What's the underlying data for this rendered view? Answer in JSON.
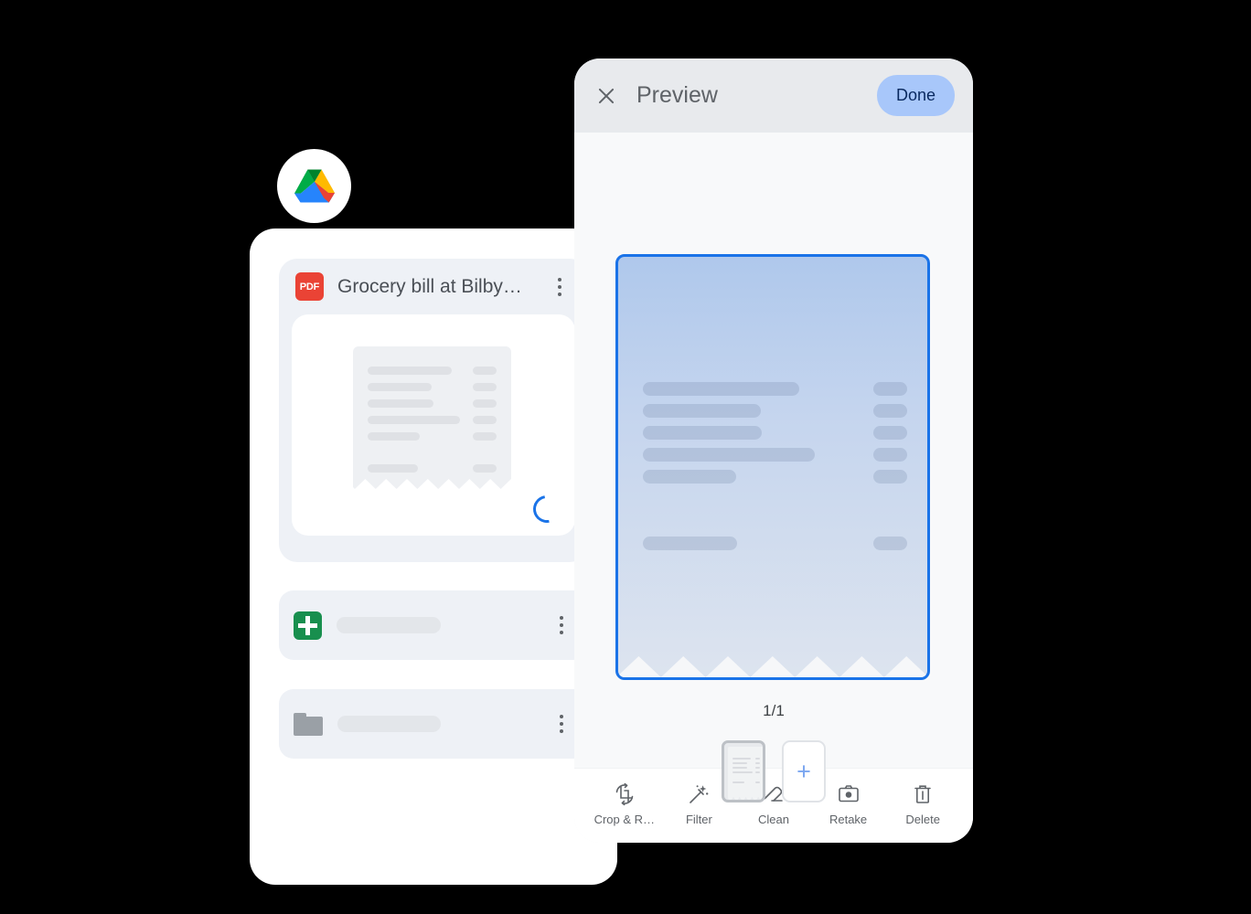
{
  "app": {
    "logo_icon": "google-drive-logo",
    "background_color": "#000000"
  },
  "files_card": {
    "featured_item": {
      "file_type_badge": "PDF",
      "badge_color": "#ea4335",
      "title": "Grocery bill at Bilby…",
      "overflow_icon": "kebab-menu-icon",
      "thumbnail_icon": "receipt-thumbnail",
      "status_icon": "loading-spinner",
      "spinner_color": "#1a73e8"
    },
    "rows": [
      {
        "icon": "google-sheets-icon",
        "icon_color": "#188f4e",
        "title": "",
        "overflow_icon": "kebab-menu-icon"
      },
      {
        "icon": "folder-icon",
        "icon_color": "#9aa0a6",
        "title": "",
        "overflow_icon": "kebab-menu-icon"
      }
    ]
  },
  "preview": {
    "header": {
      "close_icon": "close-icon",
      "title": "Preview",
      "done_label": "Done",
      "done_bg": "#a8c7fa",
      "done_text_color": "#09295f"
    },
    "document": {
      "selection_border_color": "#1a73e8",
      "content_icon": "receipt-document",
      "line_count": 6,
      "amount_count": 6
    },
    "page_counter": "1/1",
    "thumbnails": [
      {
        "name": "page-thumbnail-1",
        "selected": true,
        "label": ""
      }
    ],
    "add_page_label": "+",
    "toolbar": [
      {
        "icon": "crop-rotate-icon",
        "label": "Crop & R…"
      },
      {
        "icon": "magic-wand-filter-icon",
        "label": "Filter"
      },
      {
        "icon": "eraser-clean-icon",
        "label": "Clean"
      },
      {
        "icon": "camera-retake-icon",
        "label": "Retake"
      },
      {
        "icon": "trash-delete-icon",
        "label": "Delete"
      }
    ]
  }
}
